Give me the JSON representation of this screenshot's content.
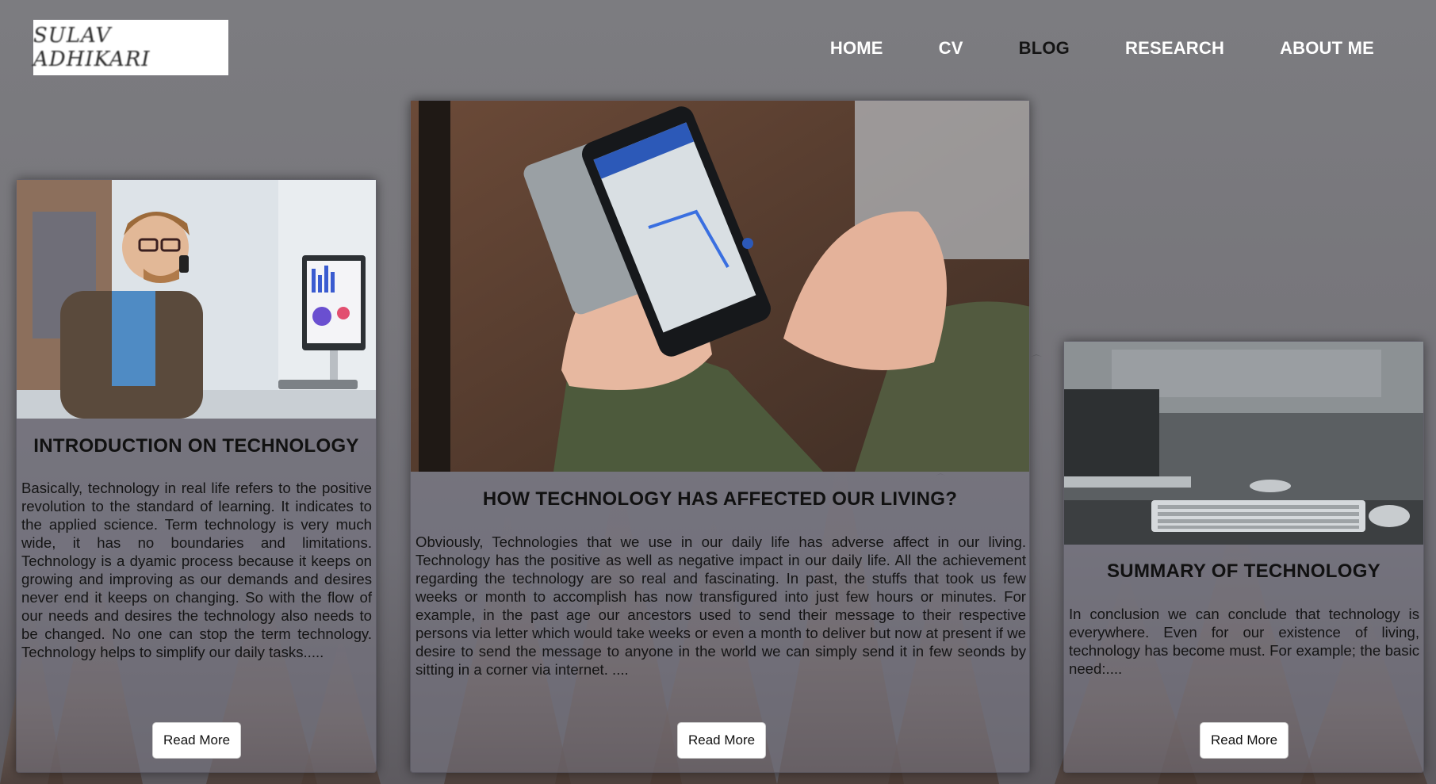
{
  "header": {
    "logo_text": "SULAV ADHIKARI",
    "nav": [
      {
        "label": "HOME"
      },
      {
        "label": "CV"
      },
      {
        "label": "BLOG"
      },
      {
        "label": "RESEARCH"
      },
      {
        "label": "ABOUT ME"
      }
    ]
  },
  "cards": [
    {
      "image": "man-on-phone-at-desk-photo",
      "title": "INTRODUCTION ON TECHNOLOGY",
      "text": "Basically, technology in real life refers to the positive revolution to the standard of learning. It indicates to the applied science. Term technology is very much wide, it has no boundaries and limitations. Technology is a dyamic process because it keeps on growing and improving as our demands and desires never end it keeps on changing. So with the flow of our needs and desires the technology also needs to be changed. No one can stop the term technology. Technology helps to simplify our daily tasks.....",
      "button": "Read More"
    },
    {
      "image": "hands-holding-smartphone-map-photo",
      "title": "HOW TECHNOLOGY HAS AFFECTED OUR LIVING?",
      "text": "Obviously, Technologies that we use in our daily life has adverse affect in our living. Technology has the positive as well as negative impact in our daily life. All the achievement regarding the technology are so real and fascinating. In past, the stuffs that took us few weeks or month to accomplish has now transfigured into just few hours or minutes. For example, in the past age our ancestors used to send their message to their respective persons via letter which would take weeks or even a month to deliver but now at present if we desire to send the message to anyone in the world we can simply send it in few seonds by sitting in a corner via internet. ....",
      "button": "Read More"
    },
    {
      "image": "laptop-keyboard-desk-photo",
      "title": "SUMMARY OF TECHNOLOGY",
      "text": "In conclusion we can conclude that technology is everywhere. Even for our existence of living, technology has become must. For example; the basic need:....",
      "button": "Read More"
    }
  ],
  "colors": {
    "nav_active": "#ffffff",
    "nav_default": "#141414",
    "page_bg": "#7a7a7e"
  }
}
